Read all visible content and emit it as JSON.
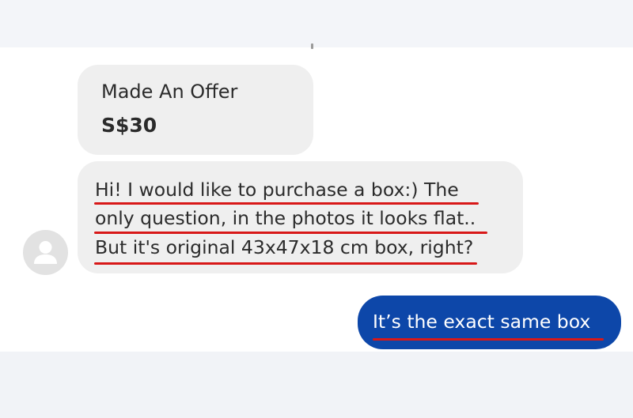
{
  "chat": {
    "offer": {
      "label": "Made An Offer",
      "price": "S$30"
    },
    "incoming_message": {
      "lines": [
        "Hi! I would like to purchase a box:) The",
        "only question, in the photos it looks flat..",
        "But it's original 43x47x18 cm box, right?"
      ]
    },
    "outgoing_message": {
      "text": "It’s the exact same box"
    }
  },
  "colors": {
    "bubble_incoming": "#efefef",
    "bubble_outgoing": "#0d47a9",
    "annotation_underline": "#d81818"
  },
  "icons": {
    "avatar": "user-silhouette-icon"
  }
}
